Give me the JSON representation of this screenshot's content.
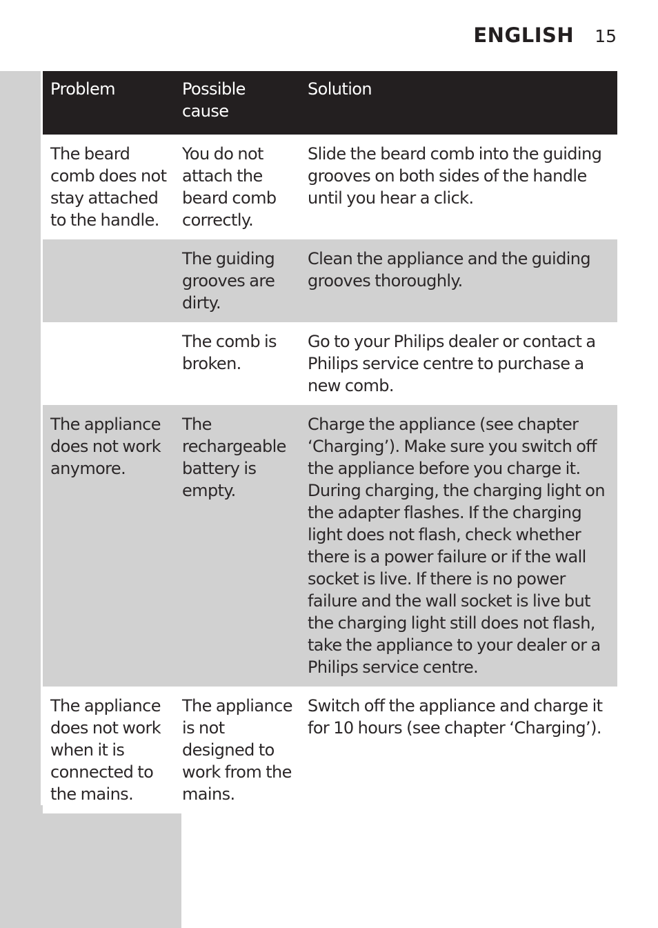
{
  "header": {
    "section": "ENGLISH",
    "page_number": "15"
  },
  "table": {
    "columns": [
      "Problem",
      "Possible cause",
      "Solution"
    ],
    "rows": [
      {
        "problem": "The beard comb does not stay attached to the handle.",
        "cause": "You do not attach the beard comb correctly.",
        "solution": "Slide the beard comb into the guiding grooves on both sides of the handle until you hear a click."
      },
      {
        "problem": "",
        "cause": "The guiding grooves are dirty.",
        "solution": "Clean the appliance and the guiding grooves thoroughly."
      },
      {
        "problem": "",
        "cause": "The comb is broken.",
        "solution": "Go to your Philips dealer or contact a Philips service centre to purchase a new comb."
      },
      {
        "problem": "The appliance does not work anymore.",
        "cause": "The rechargeable battery is empty.",
        "solution": "Charge the appliance (see chapter ‘Charging’). Make sure you switch off the appliance before you charge it. During charging, the charging light on the adapter flashes. If the charging light does not flash, check whether there is a power failure or if the wall socket is live. If there is no power failure and the wall socket is live but the charging light still does not flash, take the appliance to your dealer or a Philips service centre."
      },
      {
        "problem": "The appliance does not work when it is connected to the mains.",
        "cause": "The appliance is not designed to work from the mains.",
        "solution": "Switch off the appliance and charge it for 10 hours (see chapter ‘Charging’)."
      }
    ]
  },
  "colors": {
    "header_bg": "#231f20",
    "shade": "#d1d1d1",
    "text": "#231f20"
  }
}
